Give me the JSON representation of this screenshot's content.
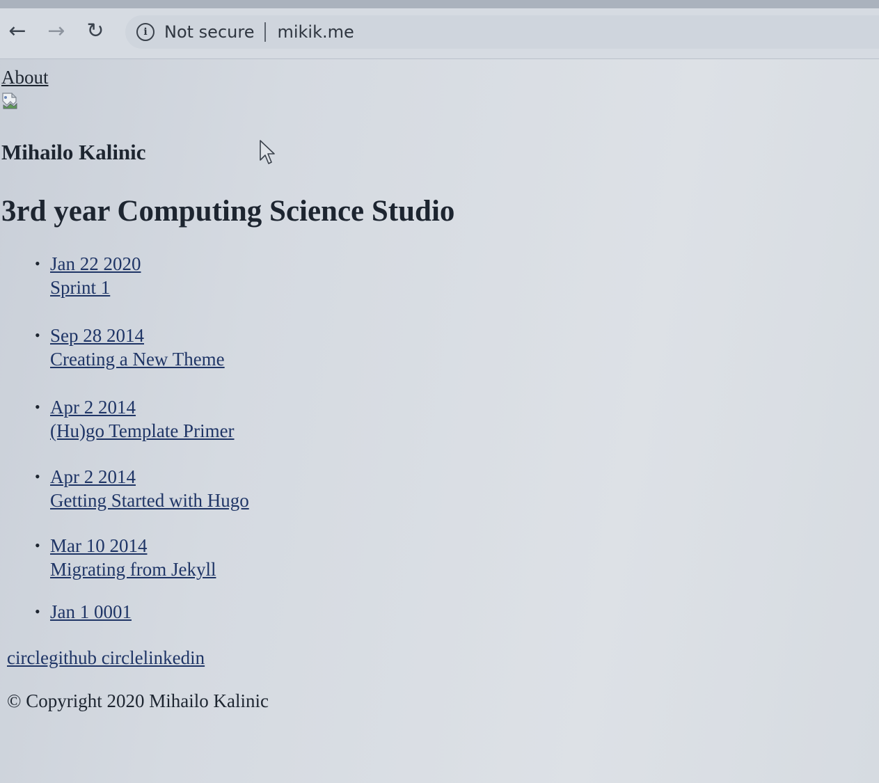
{
  "browser": {
    "security_label": "Not secure",
    "url": "mikik.me"
  },
  "nav": {
    "about_label": "About"
  },
  "header": {
    "author": "Mihailo Kalinic",
    "site_title": "3rd year Computing Science Studio"
  },
  "posts": [
    {
      "date": "Jan 22 2020",
      "title": "Sprint 1"
    },
    {
      "date": "Sep 28 2014",
      "title": "Creating a New Theme"
    },
    {
      "date": "Apr 2 2014",
      "title": "(Hu)go Template Primer"
    },
    {
      "date": "Apr 2 2014",
      "title": "Getting Started with Hugo"
    },
    {
      "date": "Mar 10 2014",
      "title": "Migrating from Jekyll"
    },
    {
      "date": "Jan 1 0001",
      "title": ""
    }
  ],
  "footer": {
    "social_links": "circlegithub circlelinkedin",
    "copyright": "© Copyright 2020 Mihailo Kalinic"
  }
}
